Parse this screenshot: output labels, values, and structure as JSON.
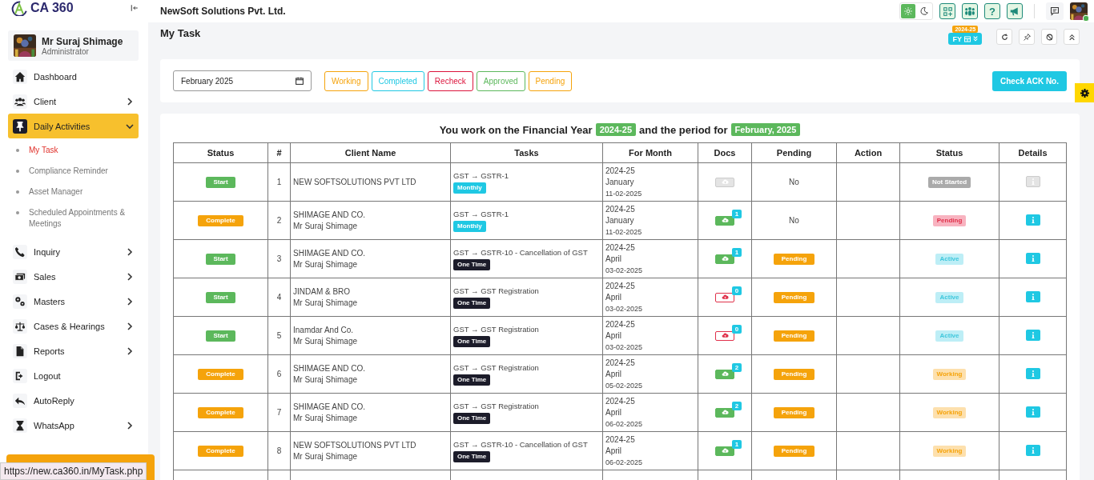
{
  "brand": {
    "name": "CA 360"
  },
  "user": {
    "name": "Mr Suraj Shimage",
    "role": "Administrator"
  },
  "sidebar": {
    "items": [
      {
        "label": "Dashboard",
        "has_submenu": false,
        "selected": false,
        "expanded": false
      },
      {
        "label": "Client",
        "has_submenu": true,
        "selected": false,
        "expanded": false
      },
      {
        "label": "Daily Activities",
        "has_submenu": true,
        "selected": true,
        "expanded": true,
        "children": [
          {
            "label": "My Task",
            "selected": true
          },
          {
            "label": "Compliance Reminder",
            "selected": false
          },
          {
            "label": "Asset Manager",
            "selected": false
          },
          {
            "label": "Scheduled Appointments & Meetings",
            "selected": false
          }
        ]
      },
      {
        "label": "Inquiry",
        "has_submenu": true,
        "selected": false,
        "expanded": false
      },
      {
        "label": "Sales",
        "has_submenu": true,
        "selected": false,
        "expanded": false
      },
      {
        "label": "Masters",
        "has_submenu": true,
        "selected": false,
        "expanded": false
      },
      {
        "label": "Cases & Hearings",
        "has_submenu": true,
        "selected": false,
        "expanded": false
      },
      {
        "label": "Reports",
        "has_submenu": true,
        "selected": false,
        "expanded": false
      },
      {
        "label": "Logout",
        "has_submenu": false,
        "selected": false,
        "expanded": false
      },
      {
        "label": "AutoReply",
        "has_submenu": false,
        "selected": false,
        "expanded": false
      },
      {
        "label": "WhatsApp",
        "has_submenu": true,
        "selected": false,
        "expanded": false
      }
    ]
  },
  "topbar": {
    "company": "NewSoft Solutions Pvt. Ltd.",
    "theme_toggle": [
      {
        "selected": true
      },
      {
        "selected": false
      }
    ],
    "help": "?"
  },
  "page": {
    "title": "My Task",
    "fy_label": "FY",
    "fy_badge": "2024-25"
  },
  "filters": {
    "month": "February 2025",
    "buttons": [
      {
        "label": "Working",
        "color": "#f5a30b"
      },
      {
        "label": "Completed",
        "color": "#1fc8e3"
      },
      {
        "label": "Recheck",
        "color": "#dc143c"
      },
      {
        "label": "Approved",
        "color": "#5cb85c"
      },
      {
        "label": "Pending",
        "color": "#f5a30b"
      }
    ],
    "check_button": "Check ACK No."
  },
  "heading": {
    "text_1": "You work on the Financial Year",
    "badge_1": "2024-25",
    "text_2": "and the period for",
    "badge_2": "February, 2025"
  },
  "table": {
    "columns": [
      "Status",
      "#",
      "Client Name",
      "Tasks",
      "For Month",
      "Docs",
      "Pending",
      "Action",
      "Status",
      "Details"
    ],
    "rows": [
      {
        "action": {
          "label": "Start",
          "kind": "start"
        },
        "number": "1",
        "client": "NEW SOFTSOLUTIONS PVT LTD",
        "task": "GST → GSTR-1",
        "frequency": {
          "label": "Monthly",
          "kind": "monthly"
        },
        "fy": "2024-25",
        "month": "January",
        "date": "11-02-2025",
        "docs": {
          "kind": "empty"
        },
        "pending": {
          "kind": "text",
          "label": "No"
        },
        "status": {
          "label": "Not Started",
          "kind": "not_started"
        },
        "details": {
          "enabled": false
        }
      },
      {
        "action": {
          "label": "Complete",
          "kind": "complete"
        },
        "number": "2",
        "client": "SHIMAGE AND CO.",
        "contact": "Mr Suraj Shimage",
        "task": "GST → GSTR-1",
        "frequency": {
          "label": "Monthly",
          "kind": "monthly"
        },
        "fy": "2024-25",
        "month": "January",
        "date": "11-02-2025",
        "docs": {
          "kind": "uploaded",
          "count": "1"
        },
        "pending": {
          "kind": "text",
          "label": "No"
        },
        "status": {
          "label": "Pending",
          "kind": "pending"
        },
        "details": {
          "enabled": true
        }
      },
      {
        "action": {
          "label": "Start",
          "kind": "start"
        },
        "number": "3",
        "client": "SHIMAGE AND CO.",
        "contact": "Mr Suraj Shimage",
        "task": "GST → GSTR-10 - Cancellation of GST",
        "frequency": {
          "label": "One Time",
          "kind": "one_time"
        },
        "fy": "2024-25",
        "month": "April",
        "date": "03-02-2025",
        "docs": {
          "kind": "uploaded",
          "count": "1"
        },
        "pending": {
          "kind": "badge",
          "label": "Pending"
        },
        "status": {
          "label": "Active",
          "kind": "active"
        },
        "details": {
          "enabled": true
        }
      },
      {
        "action": {
          "label": "Start",
          "kind": "start"
        },
        "number": "4",
        "client": "JINDAM & BRO",
        "contact": "Mr Suraj Shimage",
        "task": "GST → GST Registration",
        "frequency": {
          "label": "One Time",
          "kind": "one_time"
        },
        "fy": "2024-25",
        "month": "April",
        "date": "03-02-2025",
        "docs": {
          "kind": "missing",
          "count": "0"
        },
        "pending": {
          "kind": "badge",
          "label": "Pending"
        },
        "status": {
          "label": "Active",
          "kind": "active"
        },
        "details": {
          "enabled": true
        }
      },
      {
        "action": {
          "label": "Start",
          "kind": "start"
        },
        "number": "5",
        "client": "Inamdar And Co.",
        "contact": "Mr Suraj Shimage",
        "task": "GST → GST Registration",
        "frequency": {
          "label": "One Time",
          "kind": "one_time"
        },
        "fy": "2024-25",
        "month": "April",
        "date": "03-02-2025",
        "docs": {
          "kind": "missing",
          "count": "0"
        },
        "pending": {
          "kind": "badge",
          "label": "Pending"
        },
        "status": {
          "label": "Active",
          "kind": "active"
        },
        "details": {
          "enabled": true
        }
      },
      {
        "action": {
          "label": "Complete",
          "kind": "complete"
        },
        "number": "6",
        "client": "SHIMAGE AND CO.",
        "contact": "Mr Suraj Shimage",
        "task": "GST → GST Registration",
        "frequency": {
          "label": "One Time",
          "kind": "one_time"
        },
        "fy": "2024-25",
        "month": "April",
        "date": "05-02-2025",
        "docs": {
          "kind": "uploaded",
          "count": "2"
        },
        "pending": {
          "kind": "badge",
          "label": "Pending"
        },
        "status": {
          "label": "Working",
          "kind": "working"
        },
        "details": {
          "enabled": true
        }
      },
      {
        "action": {
          "label": "Complete",
          "kind": "complete"
        },
        "number": "7",
        "client": "SHIMAGE AND CO.",
        "contact": "Mr Suraj Shimage",
        "task": "GST → GST Registration",
        "frequency": {
          "label": "One Time",
          "kind": "one_time"
        },
        "fy": "2024-25",
        "month": "April",
        "date": "06-02-2025",
        "docs": {
          "kind": "uploaded",
          "count": "2"
        },
        "pending": {
          "kind": "badge",
          "label": "Pending"
        },
        "status": {
          "label": "Working",
          "kind": "working"
        },
        "details": {
          "enabled": true
        }
      },
      {
        "action": {
          "label": "Complete",
          "kind": "complete"
        },
        "number": "8",
        "client": "NEW SOFTSOLUTIONS PVT LTD",
        "contact": "Mr Suraj Shimage",
        "task": "GST → GSTR-10 - Cancellation of GST",
        "frequency": {
          "label": "One Time",
          "kind": "one_time"
        },
        "fy": "2024-25",
        "month": "April",
        "date": "06-02-2025",
        "docs": {
          "kind": "uploaded",
          "count": "1"
        },
        "pending": {
          "kind": "badge",
          "label": "Pending"
        },
        "status": {
          "label": "Working",
          "kind": "working"
        },
        "details": {
          "enabled": true
        }
      }
    ]
  },
  "status_bar": {
    "url": "https://new.ca360.in/MyTask.php"
  }
}
